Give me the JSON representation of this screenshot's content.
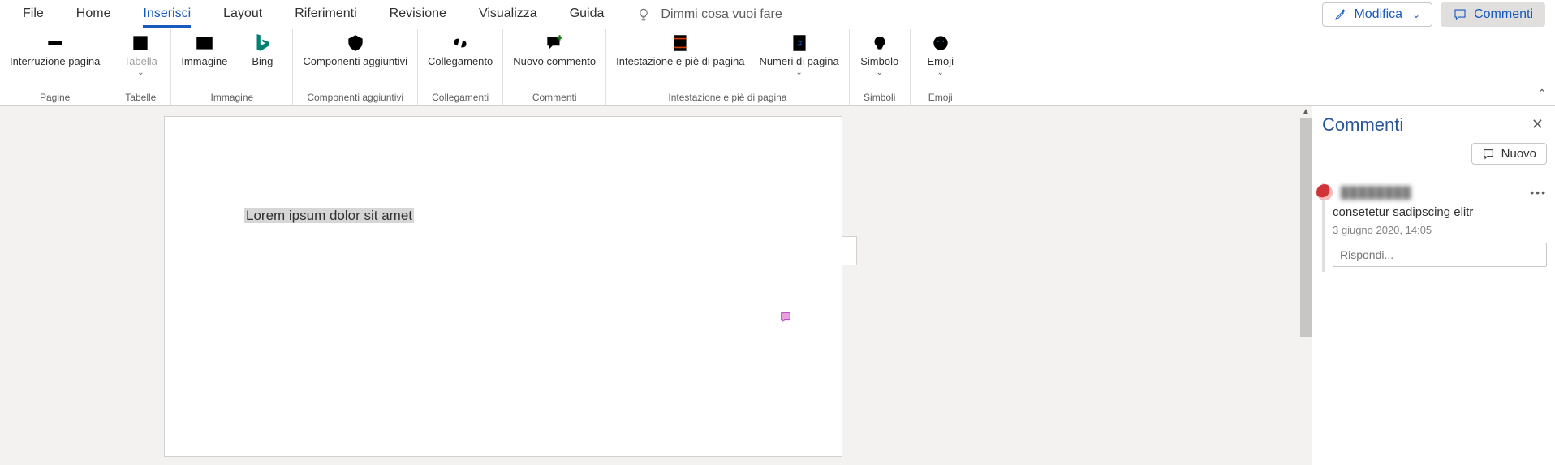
{
  "menu": {
    "tabs": [
      "File",
      "Home",
      "Inserisci",
      "Layout",
      "Riferimenti",
      "Revisione",
      "Visualizza",
      "Guida"
    ],
    "active": "Inserisci",
    "tell_me": "Dimmi cosa vuoi fare",
    "edit": "Modifica",
    "comments": "Commenti"
  },
  "ribbon": {
    "groups": [
      {
        "title": "Pagine",
        "items": [
          {
            "key": "pagebreak",
            "label": "Interruzione pagina"
          }
        ]
      },
      {
        "title": "Tabelle",
        "items": [
          {
            "key": "table",
            "label": "Tabella",
            "disabled": true,
            "dd": true
          }
        ]
      },
      {
        "title": "Immagine",
        "items": [
          {
            "key": "image",
            "label": "Immagine"
          },
          {
            "key": "bing",
            "label": "Bing"
          }
        ]
      },
      {
        "title": "Componenti aggiuntivi",
        "items": [
          {
            "key": "addins",
            "label": "Componenti aggiuntivi"
          }
        ]
      },
      {
        "title": "Collegamenti",
        "items": [
          {
            "key": "link",
            "label": "Collegamento"
          }
        ]
      },
      {
        "title": "Commenti",
        "items": [
          {
            "key": "newcomment",
            "label": "Nuovo commento"
          }
        ]
      },
      {
        "title": "Intestazione e piè di pagina",
        "items": [
          {
            "key": "headerfooter",
            "label": "Intestazione e piè di pagina"
          },
          {
            "key": "pagenum",
            "label": "Numeri di pagina",
            "dd": true
          }
        ]
      },
      {
        "title": "Simboli",
        "items": [
          {
            "key": "symbol",
            "label": "Simbolo",
            "dd": true
          }
        ]
      },
      {
        "title": "Emoji",
        "items": [
          {
            "key": "emoji",
            "label": "Emoji",
            "dd": true
          }
        ]
      }
    ]
  },
  "document": {
    "selected_text": "Lorem ipsum dolor sit amet"
  },
  "comments_pane": {
    "title": "Commenti",
    "new": "Nuovo",
    "card": {
      "author": "████████",
      "body": "consetetur sadipscing elitr",
      "time": "3 giugno 2020, 14:05",
      "reply_ph": "Rispondi..."
    }
  }
}
